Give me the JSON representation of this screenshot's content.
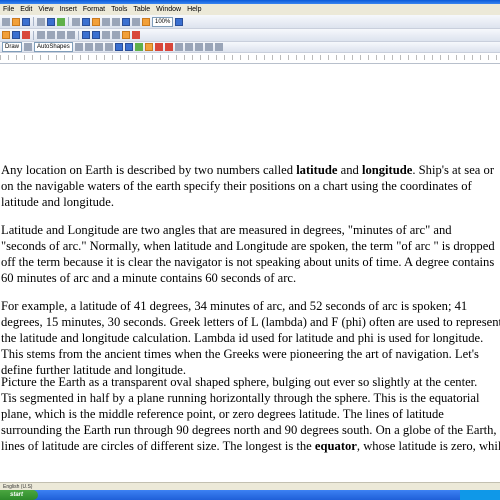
{
  "window": {
    "menu_items": [
      "File",
      "Edit",
      "View",
      "Insert",
      "Format",
      "Tools",
      "Table",
      "Window",
      "Help"
    ]
  },
  "toolbar": {
    "zoom": "100%",
    "draw_label": "Draw",
    "autoshapes_label": "AutoShapes"
  },
  "document": {
    "paragraphs": [
      {
        "lines": [
          "Any location on Earth is described by two numbers called latitude and longitude. Ship's at sea or",
          "on the navigable waters of the earth specify their positions on a chart using the coordinates of",
          "latitude and longitude."
        ]
      },
      {
        "lines": [
          "    Latitude and Longitude are two angles that are measured in degrees, \"minutes of arc\" and",
          "\"seconds of arc.\" Normally, when latitude and Longitude are spoken, the term \"of arc \" is dropped",
          "off the term because it is clear the navigator is not speaking about units of time. A degree contains",
          "60 minutes of arc and a minute contains 60 seconds of arc."
        ]
      },
      {
        "lines": [
          "  For example, a latitude of 41 degrees, 34 minutes of arc, and 52 seconds of arc is spoken; 41",
          "degrees, 15 minutes, 30 seconds. Greek letters of L (lambda) and F (phi) often are used to represent",
          "the latitude and longitude calculation. Lambda id used for latitude and phi is used for longitude.",
          "This stems from the ancient times when the Greeks were pioneering the art of navigation. Let's",
          "define further latitude and longitude."
        ]
      },
      {
        "lines": [
          "    Picture the Earth as a transparent oval shaped sphere, bulging out ever so slightly at the center.",
          "Tis segmented in half by a plane running horizontally through the sphere. This is the equatorial",
          "plane, which is the middle reference point, or zero degrees latitude.  The lines of latitude",
          "surrounding the Earth run through 90 degrees north and 90 degrees south. On a globe of the Earth,",
          "lines of latitude are circles of different size. The longest is the equator, whose latitude is zero, while"
        ]
      }
    ]
  },
  "statusbar": {
    "language": "English (U.S)"
  },
  "taskbar": {
    "start_label": "start"
  },
  "colors": {
    "taskbar": "#1f5fd8",
    "start_button": "#2d8a2a"
  }
}
